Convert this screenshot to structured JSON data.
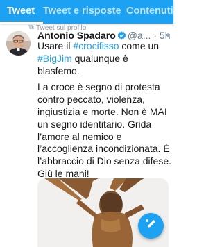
{
  "tabs": [
    {
      "label": "Tweet",
      "active": true
    },
    {
      "label": "Tweet e risposte",
      "active": false
    },
    {
      "label": "Contenuti",
      "active": false
    }
  ],
  "retweet_banner": "Tweet sul profilo",
  "tweet": {
    "author_name": "Antonio Spadaro",
    "handle": "@a...",
    "separator": "·",
    "time": "5h",
    "text": {
      "l1a": "Usare il ",
      "hashtag1": "#crocifisso",
      "l1b": " come un",
      "hashtag2": "#BigJim",
      "l2b": " qualunque è",
      "l3": "blasfemo.",
      "para2": "La croce è  segno di protesta contro peccato, violenza, ingiustizia e morte. Non è MAI un segno identitario. Grida l’amore al nemico e l’accoglienza incondizionata. È l’abbraccio di Dio senza difese. Giù le mani!"
    },
    "verified": true
  },
  "icons": {
    "verified": "verified-badge-icon",
    "retweet": "retweet-icon",
    "menu": "chevron-down-icon",
    "compose": "compose-tweet-icon"
  },
  "colors": {
    "accent": "#1da1f2",
    "text": "#14171a",
    "muted": "#657786"
  }
}
